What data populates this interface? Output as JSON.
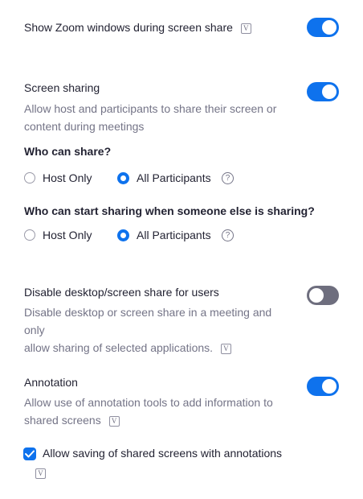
{
  "settings": {
    "show_zoom_windows": {
      "title": "Show Zoom windows during screen share",
      "icon": "V",
      "enabled": true
    },
    "screen_sharing": {
      "title": "Screen sharing",
      "desc_line1": "Allow host and participants to share their screen or",
      "desc_line2": "content during meetings",
      "enabled": true,
      "who_can_share": {
        "label": "Who can share?",
        "options": [
          "Host Only",
          "All Participants"
        ],
        "selected": "All Participants",
        "help": "?"
      },
      "who_can_start": {
        "label": "Who can start sharing when someone else is sharing?",
        "options": [
          "Host Only",
          "All Participants"
        ],
        "selected": "All Participants",
        "help": "?"
      }
    },
    "disable_desktop": {
      "title": "Disable desktop/screen share for users",
      "desc_line1": "Disable desktop or screen share in a meeting and only",
      "desc_line2": "allow sharing of selected applications.",
      "icon": "V",
      "enabled": false
    },
    "annotation": {
      "title": "Annotation",
      "desc_line1": "Allow use of annotation tools to add information to",
      "desc_line2": "shared screens",
      "icon": "V",
      "enabled": true,
      "allow_saving": {
        "label": "Allow saving of shared screens with annotations",
        "checked": true,
        "icon": "V"
      }
    }
  },
  "colors": {
    "accent": "#0e72ed",
    "text": "#232333",
    "muted": "#747487",
    "toggle_off": "#6e6e7e"
  }
}
